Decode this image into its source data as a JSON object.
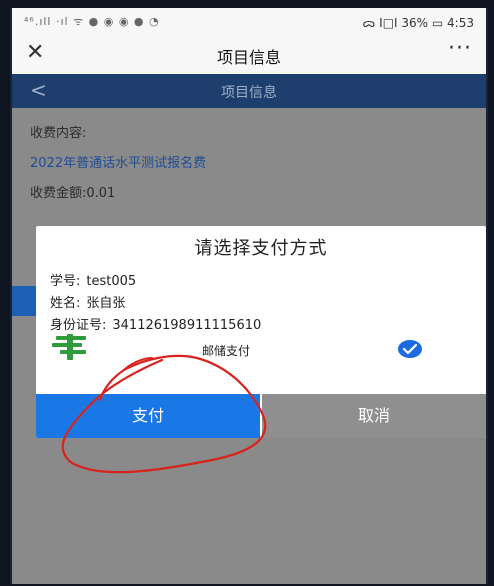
{
  "status_bar": {
    "signal": "⁴⁶.ıll ‧ıl ᯤ ● ◉ ◉ ● ◔",
    "right": "ᯅ I□I 36% ▭ 4:53"
  },
  "title_bar": {
    "close_icon": "close-icon",
    "title": "项目信息",
    "more_icon": "more-icon",
    "more_label": "···"
  },
  "nav_bar": {
    "back": "<",
    "title": "项目信息"
  },
  "content": {
    "fee_label": "收费内容:",
    "fee_item": "2022年普通话水平测试报名费",
    "fee_amount": "收费金额:0.01"
  },
  "dialog": {
    "title": "请选择支付方式",
    "student_id_label": "学号:",
    "student_id": "test005",
    "name_label": "姓名:",
    "name": "张自张",
    "id_label": "身份证号:",
    "id_number": "341126198911115610",
    "payment_method": "邮储支付",
    "payment_selected": true,
    "pay_button": "支付",
    "cancel_button": "取消"
  },
  "colors": {
    "nav": "#1e3f6e",
    "pay_button": "#1a78e6",
    "cancel_button": "#8f8f8f",
    "check": "#1c6ae0",
    "annotation": "#d8231e",
    "postal_logo": "#2f9b3a"
  }
}
